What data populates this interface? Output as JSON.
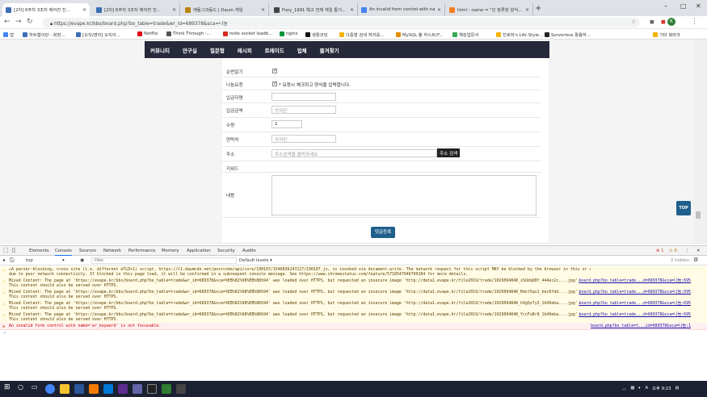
{
  "browser": {
    "tabs": [
      {
        "title": "[2차] 6주차 3조차 에어컨 진...",
        "favicon_color": "#3b6fb6",
        "active": true
      },
      {
        "title": "[2차] 6주차 3조차 에어컨 진...",
        "favicon_color": "#3b6fb6",
        "active": false
      },
      {
        "title": "애들그과동드 | Daum 게임",
        "favicon_color": "#b8860b",
        "active": false
      },
      {
        "title": "Foxy_1991 해고 전체 게임 통기...",
        "favicon_color": "#444",
        "active": false
      },
      {
        "title": "An invalid form control with na...",
        "favicon_color": "#4285f4",
        "active": false
      },
      {
        "title": "html - name = \"인 창류현 양식...",
        "favicon_color": "#f48024",
        "active": false
      }
    ],
    "new_tab": "+",
    "window_controls": [
      "–",
      "□",
      "✕"
    ],
    "url": "https://evape.kr/bbs/board.php?bo_table=trade&wr_id=689378&sca=나눔",
    "profile_initial": "K",
    "bookmarks": [
      {
        "label": "앱",
        "color": "#4285f4"
      },
      {
        "label": "하트협이란 - 회방...",
        "color": "#3b6fb6"
      },
      {
        "label": "[오직/영어] 오직이...",
        "color": "#3b6fb6"
      },
      {
        "label": "Netflix",
        "color": "#e50914"
      },
      {
        "label": "Think Through -...",
        "color": "#555"
      },
      {
        "label": "redis socket loadb...",
        "color": "#d82c20"
      },
      {
        "label": "nginx",
        "color": "#009639"
      },
      {
        "label": "생활코딩",
        "color": "#111"
      },
      {
        "label": "다중형 검색 처리를...",
        "color": "#f4b400"
      },
      {
        "label": "MySQL 툴 하스트(F...",
        "color": "#e48e00"
      },
      {
        "label": "해킹업문서",
        "color": "#34a853"
      },
      {
        "label": "진로학's Life Style...",
        "color": "#f4b400"
      },
      {
        "label": "Serverless 활용하...",
        "color": "#222"
      },
      {
        "label": "기타 북마크",
        "color": "#f4b400"
      }
    ]
  },
  "site": {
    "nav": [
      "커뮤니티",
      "연구실",
      "질문형",
      "레시피",
      "트레이드",
      "업체",
      "즐겨찾기"
    ],
    "form": {
      "fields": [
        {
          "label": "순번알기",
          "type": "checkbox",
          "checked": true
        },
        {
          "label": "나눔요청",
          "type": "checkbox",
          "checked": true,
          "note": "* 요청시 체크하고 양식을 입력합니다."
        },
        {
          "label": "입금자명",
          "type": "text",
          "value": "",
          "placeholder": ""
        },
        {
          "label": "입금금액",
          "type": "text",
          "value": "",
          "placeholder": "숫자만"
        },
        {
          "label": "수량",
          "type": "text",
          "value": "1",
          "placeholder": ""
        },
        {
          "label": "연락처",
          "type": "text",
          "value": "",
          "placeholder": "숫자만"
        },
        {
          "label": "주소",
          "type": "text",
          "value": "",
          "placeholder": "주소검색을 클릭하세요",
          "button": "주소 검색"
        },
        {
          "label": "키워드",
          "type": "text",
          "value": "",
          "placeholder": ""
        },
        {
          "label": "내용",
          "type": "textarea",
          "value": "",
          "placeholder": ""
        }
      ],
      "submit_label": "댓글등록"
    },
    "top_button": "TOP"
  },
  "devtools": {
    "tabs": [
      "Elements",
      "Console",
      "Sources",
      "Network",
      "Performance",
      "Memory",
      "Application",
      "Security",
      "Audits"
    ],
    "active_tab": "Console",
    "error_count": "1",
    "warning_count": "6",
    "context": "top",
    "filter_placeholder": "Filter",
    "levels": "Default levels ▾",
    "hidden": "2 hidden",
    "messages": [
      {
        "level": "warn",
        "text": "▸A parser-blocking, cross site (i.e. different eTLD+1) script, https://t1.daumcdn.net/postcode/api/core/190107/1546836247227/190107.js, is invoked via document.write. The network request for this script MAY be blocked by the browser in this or a future page load  postcode.v2.js:1",
        "text2": "due to poor network connectivity. If blocked in this page load, it will be confirmed in a subsequent console message. See https://www.chromestatus.com/feature/5718547946799104 for more details.",
        "source": ""
      },
      {
        "level": "warn",
        "text": "Mixed Content: The page at 'https://evape.kr/bbs/board.php?bo_table=trade&wr_id=689378&sca=%EB%82%98%EB%88%94' was loaded over HTTPS, but requested an insecure image 'http://data1.evape.kr/file2019/trade/1029094848_xSUdqU8f_444ec2c....jpg'.",
        "text2": "This content should also be served over HTTPS.",
        "source": "board.php?bo_table=trade...d=689378&sca=나눔:695"
      },
      {
        "level": "warn",
        "text": "Mixed Content: The page at 'https://evape.kr/bbs/board.php?bo_table=trade&wr_id=689378&sca=%EB%82%98%EB%88%94' was loaded over HTTPS, but requested an insecure image 'http://data1.evape.kr/file2019/trade/1029094848_Rdvt5qs1_bec6fdd....jpg'.",
        "text2": "This content should also be served over HTTPS.",
        "source": "board.php?bo_table=trade...d=689378&sca=나눔:695"
      },
      {
        "level": "warn",
        "text": "Mixed Content: The page at 'https://evape.kr/bbs/board.php?bo_table=trade&wr_id=689378&sca=%EB%82%98%EB%88%94' was loaded over HTTPS, but requested an insecure image 'http://data1.evape.kr/file2019/trade/1029094848_hXgQz7y3_1b49eba....jpg'.",
        "text2": "This content should also be served over HTTPS.",
        "source": "board.php?bo_table=trade...d=689378&sca=나눔:695"
      },
      {
        "level": "warn",
        "text": "Mixed Content: The page at 'https://evape.kr/bbs/board.php?bo_table=trade&wr_id=689378&sca=%EB%82%98%EB%88%94' was loaded over HTTPS, but requested an insecure image 'http://data1.evape.kr/file2019/trade/1029094848_YccFuRr8_1b49eba....jpg'.",
        "text2": "This content should also be served over HTTPS.",
        "source": "board.php?bo_table=trade...d=689378&sca=나눔:695"
      },
      {
        "level": "err",
        "text": "An invalid form control with name='wr_keyword' is not focusable.",
        "text2": "",
        "source": "board.php?bo_table=t...id=689378&sca=나눔:1"
      }
    ],
    "prompt": "›"
  },
  "taskbar": {
    "time": "오후 9:23",
    "lang": "A"
  }
}
